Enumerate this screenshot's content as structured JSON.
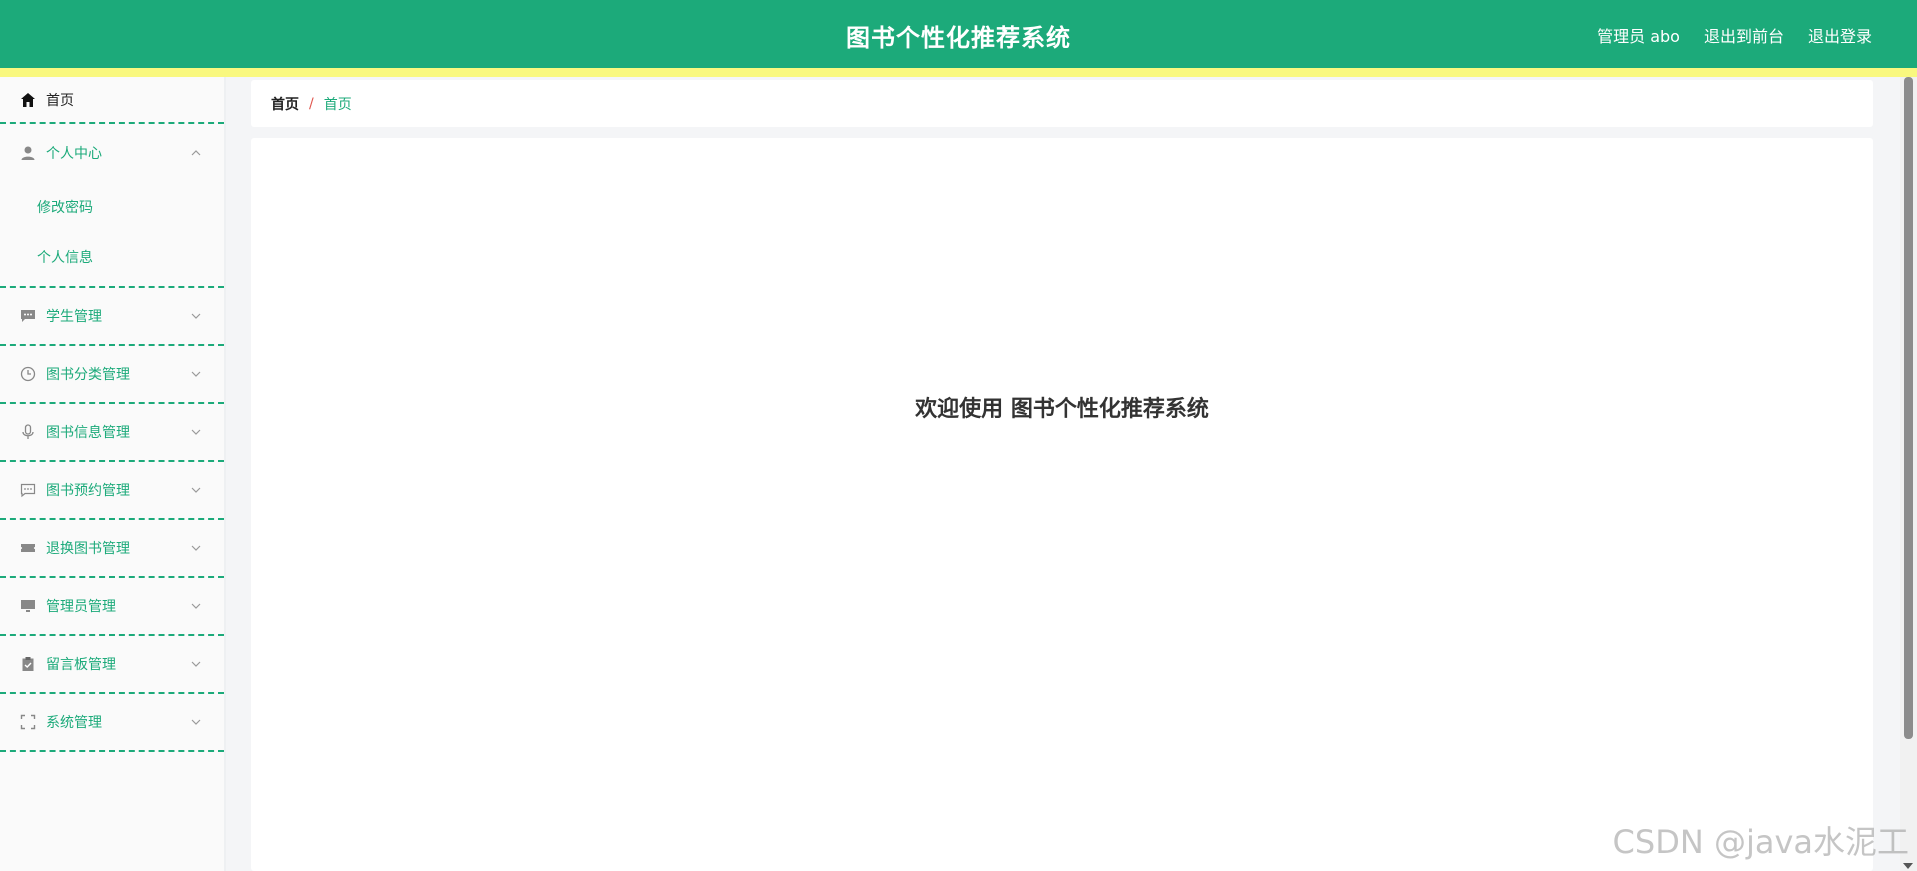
{
  "header": {
    "title": "图书个性化推荐系统",
    "user_label": "管理员 abo",
    "front_link": "退出到前台",
    "logout_link": "退出登录"
  },
  "sidebar": {
    "home": "首页",
    "personal_center": {
      "label": "个人中心",
      "children": [
        "修改密码",
        "个人信息"
      ]
    },
    "items": [
      {
        "label": "学生管理",
        "icon": "chat-icon"
      },
      {
        "label": "图书分类管理",
        "icon": "clock-icon"
      },
      {
        "label": "图书信息管理",
        "icon": "microphone-icon"
      },
      {
        "label": "图书预约管理",
        "icon": "message-icon"
      },
      {
        "label": "退换图书管理",
        "icon": "ticket-icon"
      },
      {
        "label": "管理员管理",
        "icon": "monitor-icon"
      },
      {
        "label": "留言板管理",
        "icon": "clipboard-icon"
      },
      {
        "label": "系统管理",
        "icon": "fullscreen-icon"
      }
    ]
  },
  "breadcrumb": {
    "home": "首页",
    "separator": "/",
    "current": "首页"
  },
  "main": {
    "welcome": "欢迎使用 图书个性化推荐系统"
  },
  "watermark": "CSDN @java水泥工",
  "colors": {
    "primary": "#1caa7a",
    "accent_bar": "#f9f87f",
    "separator": "#e0574f"
  }
}
